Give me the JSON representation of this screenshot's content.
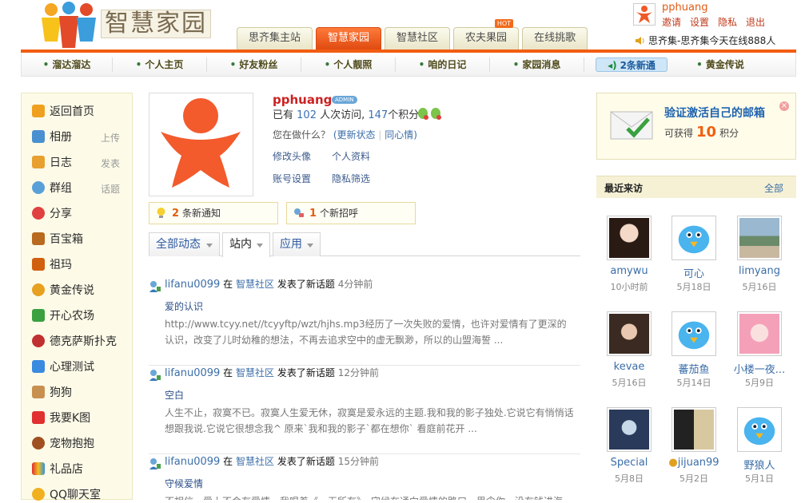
{
  "brand": {
    "logo_text": "智慧家园"
  },
  "main_tabs": [
    {
      "label": "思齐集主站",
      "active": false
    },
    {
      "label": "智慧家园",
      "active": true
    },
    {
      "label": "智慧社区",
      "active": false
    },
    {
      "label": "农夫果园",
      "active": false,
      "badge": "HOT"
    },
    {
      "label": "在线挑歌",
      "active": false
    }
  ],
  "user": {
    "name": "pphuang",
    "links": [
      "邀请",
      "设置",
      "隐私",
      "退出"
    ],
    "online_text": "思齐集-思齐集今天在线888人"
  },
  "nav": [
    "溜达溜达",
    "个人主页",
    "好友粉丝",
    "个人靓照",
    "咱的日记",
    "家园消息",
    "2条新通",
    "黄金传说"
  ],
  "sidebar": [
    {
      "label": "返回首页",
      "sub": ""
    },
    {
      "label": "相册",
      "sub": "上传"
    },
    {
      "label": "日志",
      "sub": "发表"
    },
    {
      "label": "群组",
      "sub": "话题"
    },
    {
      "label": "分享",
      "sub": ""
    },
    {
      "label": "百宝箱",
      "sub": ""
    },
    {
      "label": "祖玛",
      "sub": ""
    },
    {
      "label": "黄金传说",
      "sub": ""
    },
    {
      "label": "开心农场",
      "sub": ""
    },
    {
      "label": "德克萨斯扑克",
      "sub": ""
    },
    {
      "label": "心理测试",
      "sub": ""
    },
    {
      "label": "狗狗",
      "sub": ""
    },
    {
      "label": "我要K图",
      "sub": ""
    },
    {
      "label": "宠物抱抱",
      "sub": ""
    },
    {
      "label": "礼品店",
      "sub": ""
    },
    {
      "label": "QQ聊天室",
      "sub": ""
    }
  ],
  "profile": {
    "name": "pphuang",
    "badge": "ADMIN",
    "visits_prefix": "已有",
    "visits": "102",
    "visits_mid": "人次访问,",
    "points": "147",
    "points_suffix": "个积分",
    "doing_q": "您在做什么？",
    "update_status": "(更新状态",
    "mood": "同心情)",
    "links": [
      "修改头像",
      "个人资料",
      "账号设置",
      "隐私筛选"
    ]
  },
  "notices": [
    {
      "count": "2",
      "text": "条新通知"
    },
    {
      "count": "1",
      "text": "个新招呼"
    }
  ],
  "feed_tabs": [
    "全部动态",
    "站内",
    "应用"
  ],
  "feed": [
    {
      "user": "lifanu0099",
      "in_word": "在",
      "community": "智慧社区",
      "action": "发表了新话题",
      "time": "4分钟前",
      "title": "爱的认识",
      "body": "http://www.tcyy.net//tcyyftp/wzt/hjhs.mp3经历了一次失败的爱情，也许对爱情有了更深的认识，改变了儿时幼稚的想法，不再去追求空中的虚无飘渺，所以的山盟海誓 ..."
    },
    {
      "user": "lifanu0099",
      "in_word": "在",
      "community": "智慧社区",
      "action": "发表了新话题",
      "time": "12分钟前",
      "title": "空白",
      "body": "人生不止，寂寞不已。寂寞人生爱无休，寂寞是爱永远的主题.我和我的影子独处.它说它有悄悄话想跟我说.它说它很想念我^ 原来`我和我的影子`都在想你` 看庭前花开 ..."
    },
    {
      "user": "lifanu0099",
      "in_word": "在",
      "community": "智慧社区",
      "action": "发表了新话题",
      "time": "15分钟前",
      "title": "守候爱情",
      "body": "不相信，爱上不会有爱情，我唱着《一无所有》，守候在通向爱情的路口，思念你，没有钱进海"
    }
  ],
  "verify": {
    "title": "验证激活自己的邮箱",
    "prefix": "可获得",
    "points": "10",
    "suffix": "积分"
  },
  "visitors_header": {
    "title": "最近来访",
    "all": "全部"
  },
  "visitors": [
    {
      "name": "amywu",
      "date": "10小时前",
      "avatar": "photo-girl"
    },
    {
      "name": "可心",
      "date": "5月18日",
      "avatar": "bird"
    },
    {
      "name": "limyang",
      "date": "5月16日",
      "avatar": "photo-outdoor"
    },
    {
      "name": "kevae",
      "date": "5月16日",
      "avatar": "photo-boy"
    },
    {
      "name": "蕃茄鱼",
      "date": "5月14日",
      "avatar": "bird"
    },
    {
      "name": "小楼一夜...",
      "date": "5月9日",
      "avatar": "anime"
    },
    {
      "name": "Special",
      "date": "5月8日",
      "avatar": "photo-blue"
    },
    {
      "name": "jijuan99",
      "date": "5月2日",
      "avatar": "photo-dark"
    },
    {
      "name": "野狼人",
      "date": "5月1日",
      "avatar": "bird"
    }
  ],
  "colors": {
    "accent": "#f25d12",
    "link": "#3b6ea8",
    "sidebar_bg": "#fdfbe8"
  }
}
